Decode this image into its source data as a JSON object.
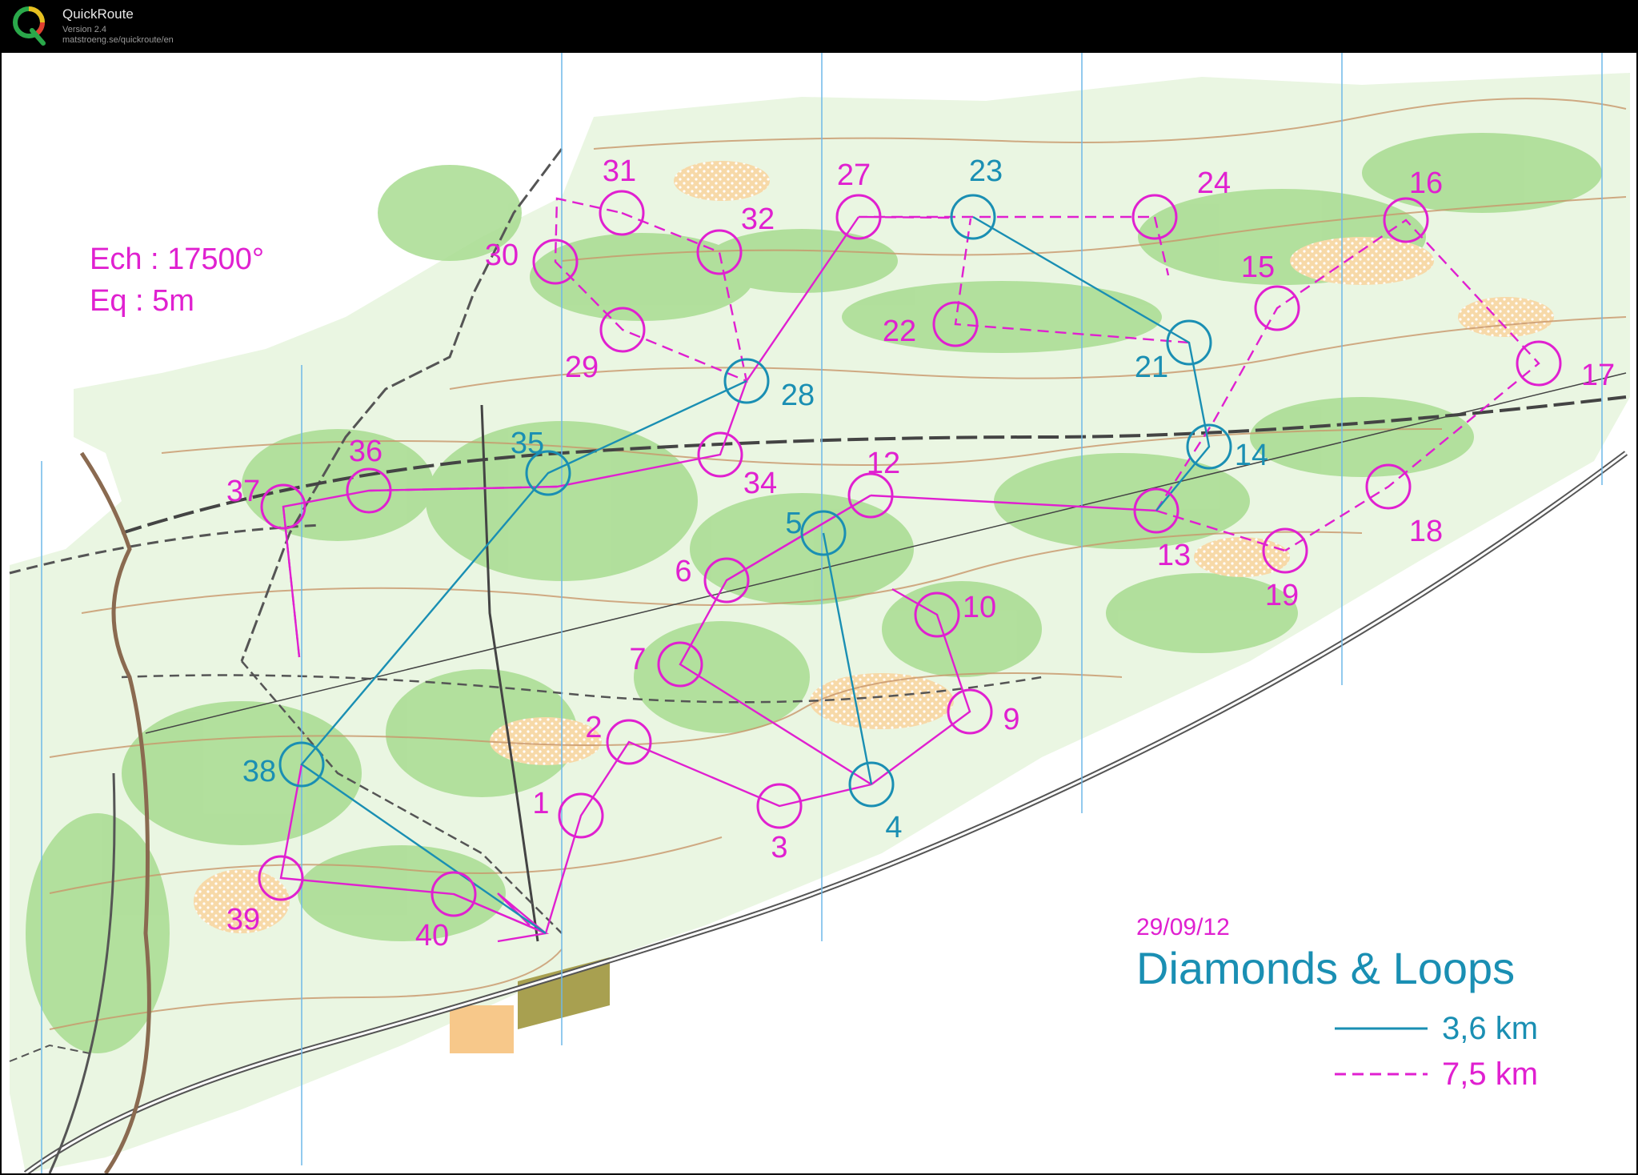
{
  "app": {
    "name": "QuickRoute",
    "version": "Version 2.4",
    "url": "matstroeng.se/quickroute/en",
    "logo_letter": "Q"
  },
  "map": {
    "scale": "Ech : 17500°",
    "equidistance": "Eq : 5m",
    "date": "29/09/12",
    "title": "Diamonds & Loops",
    "legend": [
      {
        "style": "solid",
        "color": "#1a8fb3",
        "label": "3,6 km"
      },
      {
        "style": "dashed",
        "color": "#e020d0",
        "label": "7,5 km"
      }
    ],
    "colors": {
      "short_course": "#1a8fb3",
      "long_course": "#e020d0",
      "forest_green": "#a8dc90",
      "open_yellow": "#f7d9a8",
      "contour": "#c8966a",
      "road": "#555555",
      "magnetic_north": "#6fb8e8"
    }
  },
  "controls": [
    {
      "n": "1",
      "c": "m"
    },
    {
      "n": "2",
      "c": "m"
    },
    {
      "n": "3",
      "c": "m"
    },
    {
      "n": "4",
      "c": "b"
    },
    {
      "n": "5",
      "c": "b"
    },
    {
      "n": "6",
      "c": "m"
    },
    {
      "n": "7",
      "c": "m"
    },
    {
      "n": "9",
      "c": "m"
    },
    {
      "n": "10",
      "c": "m"
    },
    {
      "n": "12",
      "c": "m"
    },
    {
      "n": "13",
      "c": "m"
    },
    {
      "n": "14",
      "c": "b"
    },
    {
      "n": "15",
      "c": "m"
    },
    {
      "n": "16",
      "c": "m"
    },
    {
      "n": "17",
      "c": "m"
    },
    {
      "n": "18",
      "c": "m"
    },
    {
      "n": "19",
      "c": "m"
    },
    {
      "n": "21",
      "c": "b"
    },
    {
      "n": "22",
      "c": "m"
    },
    {
      "n": "23",
      "c": "b"
    },
    {
      "n": "24",
      "c": "m"
    },
    {
      "n": "27",
      "c": "m"
    },
    {
      "n": "28",
      "c": "b"
    },
    {
      "n": "29",
      "c": "m"
    },
    {
      "n": "30",
      "c": "m"
    },
    {
      "n": "31",
      "c": "m"
    },
    {
      "n": "32",
      "c": "m"
    },
    {
      "n": "34",
      "c": "m"
    },
    {
      "n": "35",
      "c": "b"
    },
    {
      "n": "36",
      "c": "m"
    },
    {
      "n": "37",
      "c": "m"
    },
    {
      "n": "38",
      "c": "b"
    },
    {
      "n": "39",
      "c": "m"
    },
    {
      "n": "40",
      "c": "m"
    }
  ]
}
